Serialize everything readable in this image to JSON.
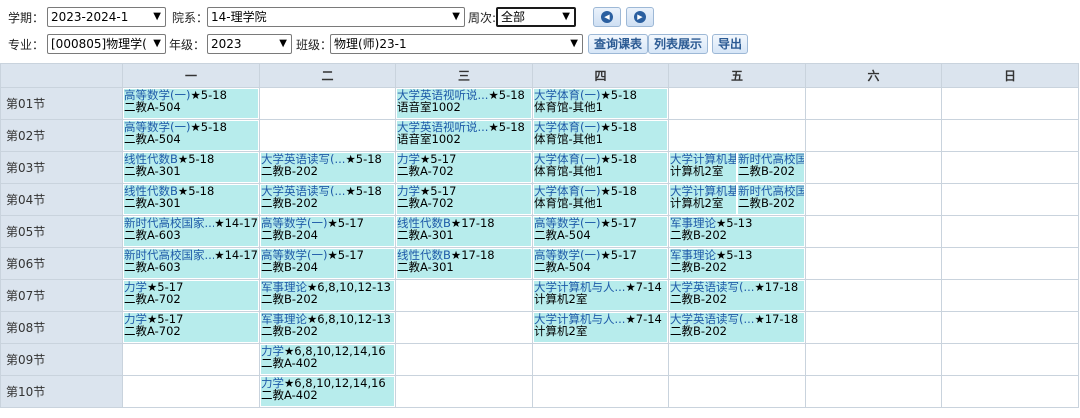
{
  "filters": {
    "term_label": "学期：",
    "term_value": "2023-2024-1",
    "dept_label": "院系：",
    "dept_value": "14-理学院",
    "week_label": "周次:",
    "week_value": "全部",
    "major_label": "专业：",
    "major_value": "[000805]物理学(",
    "grade_label": "年级：",
    "grade_value": "2023",
    "class_label": "班级：",
    "class_value": "物理(师)23-1"
  },
  "buttons": {
    "query": "查询课表",
    "list": "列表展示",
    "export": "导出",
    "prev_icon": "prev-week-icon",
    "next_icon": "next-week-icon"
  },
  "colors": {
    "course_bg": "#b7ecec",
    "course_name": "#1e5aa8",
    "header_bg": "#dbe4ee",
    "button_text": "#2b5a93"
  },
  "timetable": {
    "days": [
      "一",
      "二",
      "三",
      "四",
      "五",
      "六",
      "日"
    ],
    "periods": [
      {
        "label": "第01节",
        "cells": [
          {
            "name": "高等数学(一)",
            "weeks": "★5-18",
            "room": "二教A-504"
          },
          null,
          {
            "name": "大学英语视听说...",
            "weeks": "★5-18",
            "room": "语音室1002"
          },
          {
            "name": "大学体育(一)",
            "weeks": "★5-18",
            "room": "体育馆-其他1"
          },
          null,
          null,
          null
        ]
      },
      {
        "label": "第02节",
        "cells": [
          {
            "name": "高等数学(一)",
            "weeks": "★5-18",
            "room": "二教A-504"
          },
          null,
          {
            "name": "大学英语视听说...",
            "weeks": "★5-18",
            "room": "语音室1002"
          },
          {
            "name": "大学体育(一)",
            "weeks": "★5-18",
            "room": "体育馆-其他1"
          },
          null,
          null,
          null
        ]
      },
      {
        "label": "第03节",
        "cells": [
          {
            "name": "线性代数B",
            "weeks": "★5-18",
            "room": "二教A-301"
          },
          {
            "name": "大学英语读写(...",
            "weeks": "★5-18",
            "room": "二教B-202"
          },
          {
            "name": "力学",
            "weeks": "★5-17",
            "room": "二教A-702"
          },
          {
            "name": "大学体育(一)",
            "weeks": "★5-18",
            "room": "体育馆-其他1"
          },
          {
            "split": [
              {
                "name": "大学计算机基",
                "room": "计算机2室"
              },
              {
                "name": "新时代高校国",
                "room": "二教B-202"
              }
            ]
          },
          null,
          null
        ]
      },
      {
        "label": "第04节",
        "cells": [
          {
            "name": "线性代数B",
            "weeks": "★5-18",
            "room": "二教A-301"
          },
          {
            "name": "大学英语读写(...",
            "weeks": "★5-18",
            "room": "二教B-202"
          },
          {
            "name": "力学",
            "weeks": "★5-17",
            "room": "二教A-702"
          },
          {
            "name": "大学体育(一)",
            "weeks": "★5-18",
            "room": "体育馆-其他1"
          },
          {
            "split": [
              {
                "name": "大学计算机基",
                "room": "计算机2室"
              },
              {
                "name": "新时代高校国",
                "room": "二教B-202"
              }
            ]
          },
          null,
          null
        ]
      },
      {
        "label": "第05节",
        "cells": [
          {
            "name": "新时代高校国家...",
            "weeks": "★14-17",
            "room": "二教A-603"
          },
          {
            "name": "高等数学(一)",
            "weeks": "★5-17",
            "room": "二教B-204"
          },
          {
            "name": "线性代数B",
            "weeks": "★17-18",
            "room": "二教A-301"
          },
          {
            "name": "高等数学(一)",
            "weeks": "★5-17",
            "room": "二教A-504"
          },
          {
            "name": "军事理论",
            "weeks": "★5-13",
            "room": "二教B-202"
          },
          null,
          null
        ]
      },
      {
        "label": "第06节",
        "cells": [
          {
            "name": "新时代高校国家...",
            "weeks": "★14-17",
            "room": "二教A-603"
          },
          {
            "name": "高等数学(一)",
            "weeks": "★5-17",
            "room": "二教B-204"
          },
          {
            "name": "线性代数B",
            "weeks": "★17-18",
            "room": "二教A-301"
          },
          {
            "name": "高等数学(一)",
            "weeks": "★5-17",
            "room": "二教A-504"
          },
          {
            "name": "军事理论",
            "weeks": "★5-13",
            "room": "二教B-202"
          },
          null,
          null
        ]
      },
      {
        "label": "第07节",
        "cells": [
          {
            "name": "力学",
            "weeks": "★5-17",
            "room": "二教A-702"
          },
          {
            "name": "军事理论",
            "weeks": "★6,8,10,12-13",
            "room": "二教B-202"
          },
          null,
          {
            "name": "大学计算机与人...",
            "weeks": "★7-14",
            "room": "计算机2室"
          },
          {
            "name": "大学英语读写(...",
            "weeks": "★17-18",
            "room": "二教B-202"
          },
          null,
          null
        ]
      },
      {
        "label": "第08节",
        "cells": [
          {
            "name": "力学",
            "weeks": "★5-17",
            "room": "二教A-702"
          },
          {
            "name": "军事理论",
            "weeks": "★6,8,10,12-13",
            "room": "二教B-202"
          },
          null,
          {
            "name": "大学计算机与人...",
            "weeks": "★7-14",
            "room": "计算机2室"
          },
          {
            "name": "大学英语读写(...",
            "weeks": "★17-18",
            "room": "二教B-202"
          },
          null,
          null
        ]
      },
      {
        "label": "第09节",
        "cells": [
          null,
          {
            "name": "力学",
            "weeks": "★6,8,10,12,14,16",
            "room": "二教A-402"
          },
          null,
          null,
          null,
          null,
          null
        ]
      },
      {
        "label": "第10节",
        "cells": [
          null,
          {
            "name": "力学",
            "weeks": "★6,8,10,12,14,16",
            "room": "二教A-402"
          },
          null,
          null,
          null,
          null,
          null
        ]
      }
    ]
  }
}
